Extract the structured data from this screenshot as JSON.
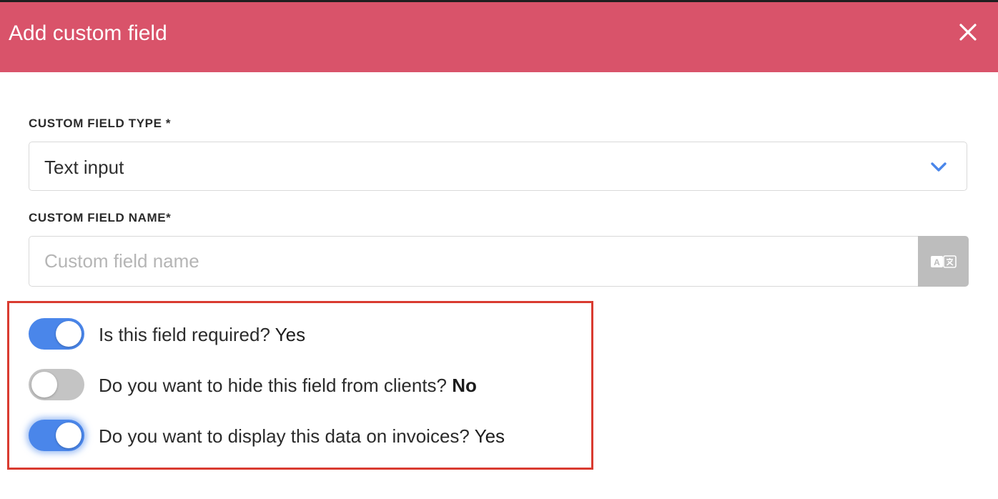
{
  "dialog": {
    "title": "Add custom field"
  },
  "form": {
    "type_label": "CUSTOM FIELD TYPE *",
    "type_value": "Text input",
    "name_label": "CUSTOM FIELD NAME*",
    "name_placeholder": "Custom field name",
    "name_value": "",
    "translate_icon_text": "A 文"
  },
  "toggles": [
    {
      "question": "Is this field required?",
      "answer": "Yes",
      "enabled": true
    },
    {
      "question": "Do you want to hide this field from clients?",
      "answer": "No",
      "enabled": false
    },
    {
      "question": "Do you want to display this data on invoices?",
      "answer": "Yes",
      "enabled": true
    }
  ],
  "colors": {
    "header": "#d9536a",
    "accent": "#4a86ea",
    "highlight": "#d93b30",
    "toggle_off": "#c4c4c4"
  },
  "icons": {
    "close": "close-icon",
    "dropdown": "chevron-down-icon",
    "translate": "translate-icon"
  }
}
